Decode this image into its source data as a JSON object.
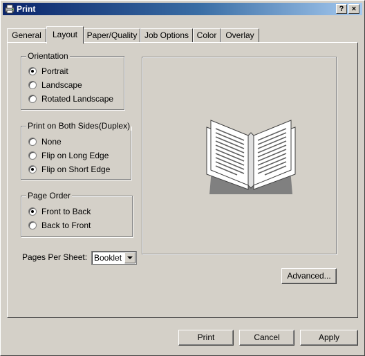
{
  "window": {
    "title": "Print",
    "help_label": "?",
    "close_label": "×"
  },
  "tabs": [
    {
      "label": "General",
      "active": false
    },
    {
      "label": "Layout",
      "active": true
    },
    {
      "label": "Paper/Quality",
      "active": false
    },
    {
      "label": "Job Options",
      "active": false
    },
    {
      "label": "Color",
      "active": false
    },
    {
      "label": "Overlay",
      "active": false
    }
  ],
  "orientation": {
    "label": "Orientation",
    "options": [
      {
        "label": "Portrait",
        "checked": true
      },
      {
        "label": "Landscape",
        "checked": false
      },
      {
        "label": "Rotated Landscape",
        "checked": false
      }
    ]
  },
  "duplex": {
    "label": "Print on Both Sides(Duplex)",
    "options": [
      {
        "label": "None",
        "checked": false
      },
      {
        "label": "Flip on Long Edge",
        "checked": false
      },
      {
        "label": "Flip on Short Edge",
        "checked": true
      }
    ]
  },
  "page_order": {
    "label": "Page Order",
    "options": [
      {
        "label": "Front to Back",
        "checked": true
      },
      {
        "label": "Back to Front",
        "checked": false
      }
    ]
  },
  "pages_per_sheet": {
    "label": "Pages Per Sheet:",
    "value": "Booklet"
  },
  "buttons": {
    "advanced": "Advanced...",
    "print": "Print",
    "cancel": "Cancel",
    "apply": "Apply"
  },
  "colors": {
    "face": "#d4d0c8",
    "title_start": "#0a246a",
    "title_end": "#a6caf0"
  }
}
